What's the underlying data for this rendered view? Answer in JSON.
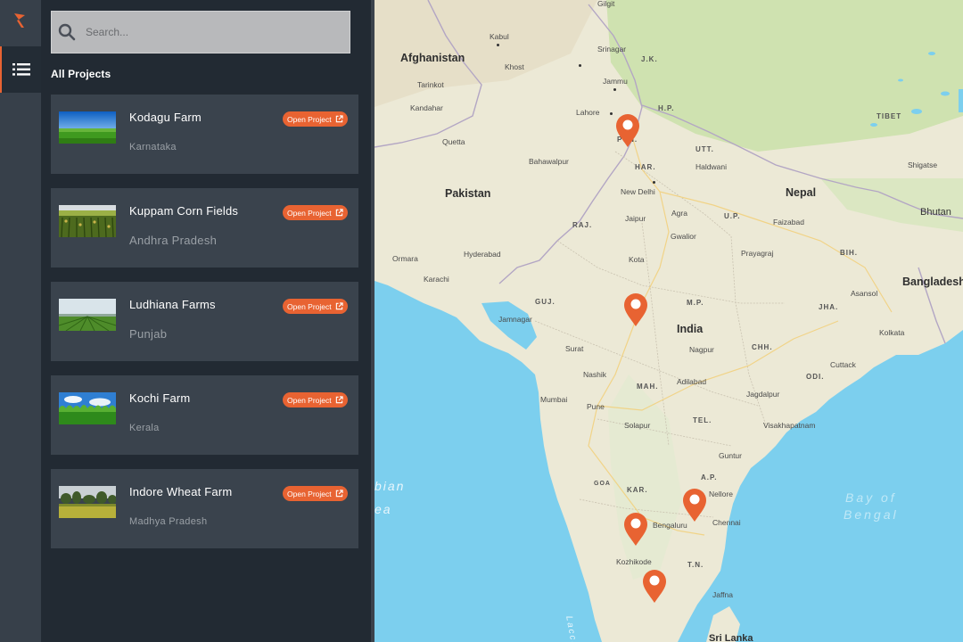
{
  "search": {
    "placeholder": "Search..."
  },
  "sidebar": {
    "heading": "All Projects",
    "open_label": "Open Project"
  },
  "projects": [
    {
      "name": "Kodagu Farm",
      "region": "Karnataka"
    },
    {
      "name": "Kuppam Corn Fields",
      "region": "Andhra Pradesh"
    },
    {
      "name": "Ludhiana Farms",
      "region": "Punjab"
    },
    {
      "name": "Kochi Farm",
      "region": "Kerala"
    },
    {
      "name": "Indore Wheat Farm",
      "region": "Madhya Pradesh"
    }
  ],
  "map": {
    "countries": [
      "Afghanistan",
      "Pakistan",
      "Nepal",
      "India",
      "Bangladesh",
      "Bhutan",
      "TIBET",
      "Sri Lanka"
    ],
    "states": [
      "J.K.",
      "H.P.",
      "PUN.",
      "HAR.",
      "UTT.",
      "U.P.",
      "RAJ.",
      "BIH.",
      "GUJ.",
      "M.P.",
      "JHA.",
      "MAH.",
      "CHH.",
      "ODI.",
      "TEL.",
      "GOA",
      "KAR.",
      "A.P.",
      "T.N."
    ],
    "cities": [
      "Gilgit",
      "Kabul",
      "Srinagar",
      "Khost",
      "Tarinkot",
      "Jammu",
      "Kandahar",
      "Lahore",
      "Quetta",
      "Bahawalpur",
      "New Delhi",
      "Haldwani",
      "Shigatse",
      "Jaipur",
      "Agra",
      "Faizabad",
      "Gwalior",
      "Hyderabad",
      "Kota",
      "Prayagraj",
      "Ormara",
      "Karachi",
      "Asansol",
      "Jamnagar",
      "Kolkata",
      "Surat",
      "Nagpur",
      "Cuttack",
      "Nashik",
      "Adilabad",
      "Mumbai",
      "Pune",
      "Jagdalpur",
      "Solapur",
      "Visakhapatnam",
      "Guntur",
      "Nellore",
      "Bengaluru",
      "Chennai",
      "Kozhikode",
      "Jaffna"
    ],
    "seas": [
      "bian",
      "ea",
      "Laccadive",
      "Bay of",
      "Bengal"
    ],
    "colors": {
      "water": "#7ccfee",
      "land": "#ece9d6",
      "green": "#cfe2b0",
      "pin": "#e86332"
    }
  }
}
